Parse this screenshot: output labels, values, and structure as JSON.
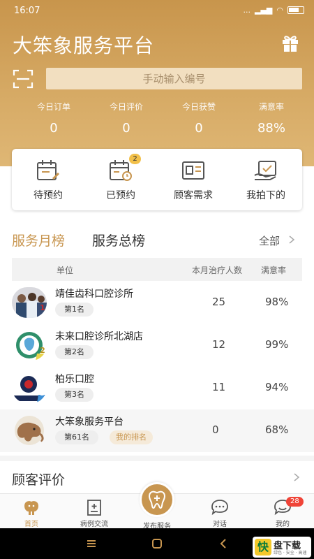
{
  "status_bar": {
    "time": "16:07",
    "dots": "...",
    "battery": "battery"
  },
  "header": {
    "title": "大笨象服务平台",
    "gift_icon": "gift-icon",
    "scan_icon": "scan-icon",
    "input_placeholder": "手动输入编号"
  },
  "stats": [
    {
      "label": "今日订单",
      "value": "0"
    },
    {
      "label": "今日评价",
      "value": "0"
    },
    {
      "label": "今日获赞",
      "value": "0"
    },
    {
      "label": "满意率",
      "value": "88%"
    }
  ],
  "quick_actions": [
    {
      "label": "待预约",
      "icon": "calendar-pen-icon"
    },
    {
      "label": "已预约",
      "icon": "calendar-clock-icon",
      "badge": "2"
    },
    {
      "label": "顾客需求",
      "icon": "id-card-icon"
    },
    {
      "label": "我拍下的",
      "icon": "hand-calendar-icon"
    }
  ],
  "ranking": {
    "tab_month": "服务月榜",
    "tab_total": "服务总榜",
    "all": "全部",
    "headers": {
      "unit": "单位",
      "count": "本月治疗人数",
      "sat": "满意率"
    },
    "rows": [
      {
        "name": "靖佳齿科口腔诊所",
        "rank": "第1名",
        "rank_num": "1",
        "count": "25",
        "sat": "98%"
      },
      {
        "name": "未来口腔诊所北湖店",
        "rank": "第2名",
        "rank_num": "2",
        "count": "12",
        "sat": "99%"
      },
      {
        "name": "柏乐口腔",
        "rank": "第3名",
        "rank_num": "3",
        "count": "11",
        "sat": "94%"
      },
      {
        "name": "大笨象服务平台",
        "rank": "第61名",
        "mine": "我的排名",
        "count": "0",
        "sat": "68%"
      }
    ]
  },
  "reviews": {
    "title": "顾客评价"
  },
  "tabbar": [
    {
      "label": "首页",
      "icon": "elephant-icon"
    },
    {
      "label": "病例交流",
      "icon": "case-icon"
    },
    {
      "label": "发布服务",
      "icon": "tooth-plus-icon"
    },
    {
      "label": "对话",
      "icon": "chat-icon"
    },
    {
      "label": "我的",
      "icon": "profile-chat-icon",
      "badge": "28"
    }
  ],
  "watermark": {
    "logo": "快",
    "text": "盘下载",
    "sub": "绿色 · 安全 · 高速"
  },
  "colors": {
    "accent": "#c89650",
    "header": "#d1a35d",
    "badge": "#f04438"
  }
}
